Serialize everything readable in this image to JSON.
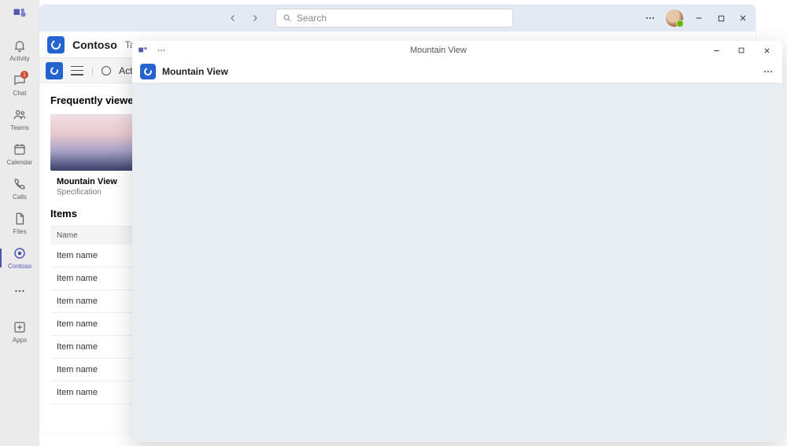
{
  "search": {
    "placeholder": "Search"
  },
  "rail": {
    "items": [
      {
        "label": "Activity"
      },
      {
        "label": "Chat",
        "badge": "1"
      },
      {
        "label": "Teams"
      },
      {
        "label": "Calendar"
      },
      {
        "label": "Calls"
      },
      {
        "label": "Files"
      },
      {
        "label": "Contoso"
      }
    ],
    "apps_label": "Apps"
  },
  "app": {
    "name": "Contoso",
    "tab_partial": "Tab"
  },
  "command": {
    "action_label": "Action"
  },
  "frequently": {
    "heading": "Frequently viewed",
    "card": {
      "title": "Mountain View",
      "subtitle": "Specification"
    }
  },
  "items": {
    "heading": "Items",
    "column": "Name",
    "rows": [
      "Item name",
      "Item name",
      "Item name",
      "Item name",
      "Item name",
      "Item name",
      "Item name"
    ]
  },
  "popup": {
    "window_title": "Mountain View",
    "header_title": "Mountain View"
  }
}
